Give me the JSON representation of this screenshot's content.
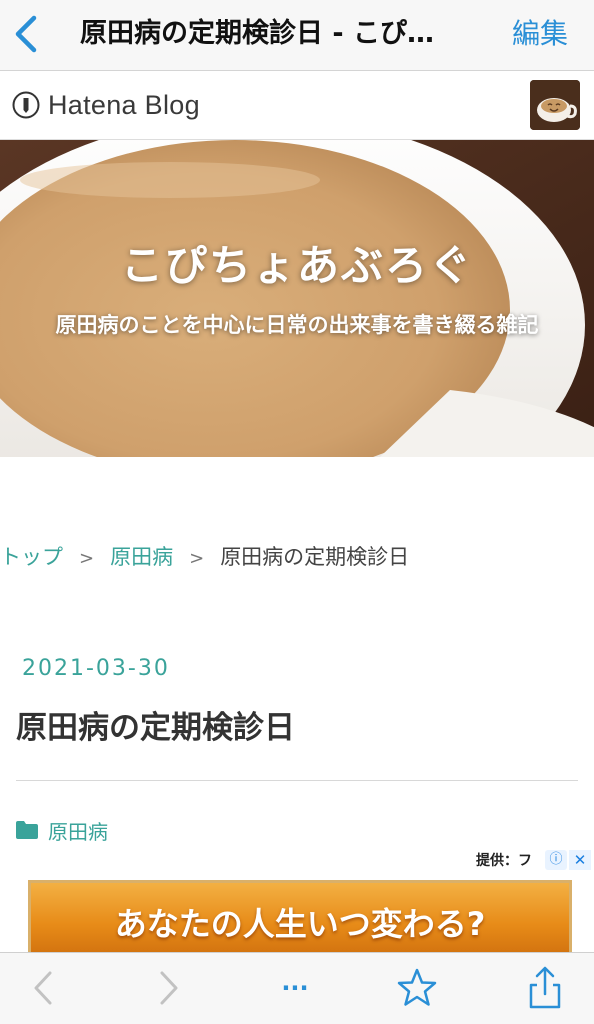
{
  "nav": {
    "title": "原田病の定期検診日 - こぴ…",
    "edit_label": "編集",
    "accent_color": "#2a8fd6"
  },
  "hatena": {
    "logo_text": "Hatena Blog"
  },
  "hero": {
    "blog_title": "こぴちょあぶろぐ",
    "description": "原田病のことを中心に日常の出来事を書き綴る雑記"
  },
  "breadcrumb": {
    "items": [
      "トップ",
      "原田病"
    ],
    "separator": ">",
    "current": "原田病の定期検診日"
  },
  "article": {
    "date": "2021-03-30",
    "title": "原田病の定期検診日",
    "category": "原田病",
    "accent_color": "#3aa39a"
  },
  "ad": {
    "provider": "提供：フ",
    "info_icon": "ⓘ",
    "close_icon": "✕",
    "headline": "あなたの人生いつ変わる?"
  },
  "toolbar": {
    "icons": [
      "back-icon",
      "forward-icon",
      "more-icon",
      "bookmark-star-icon",
      "share-icon"
    ],
    "more_text": "···"
  }
}
